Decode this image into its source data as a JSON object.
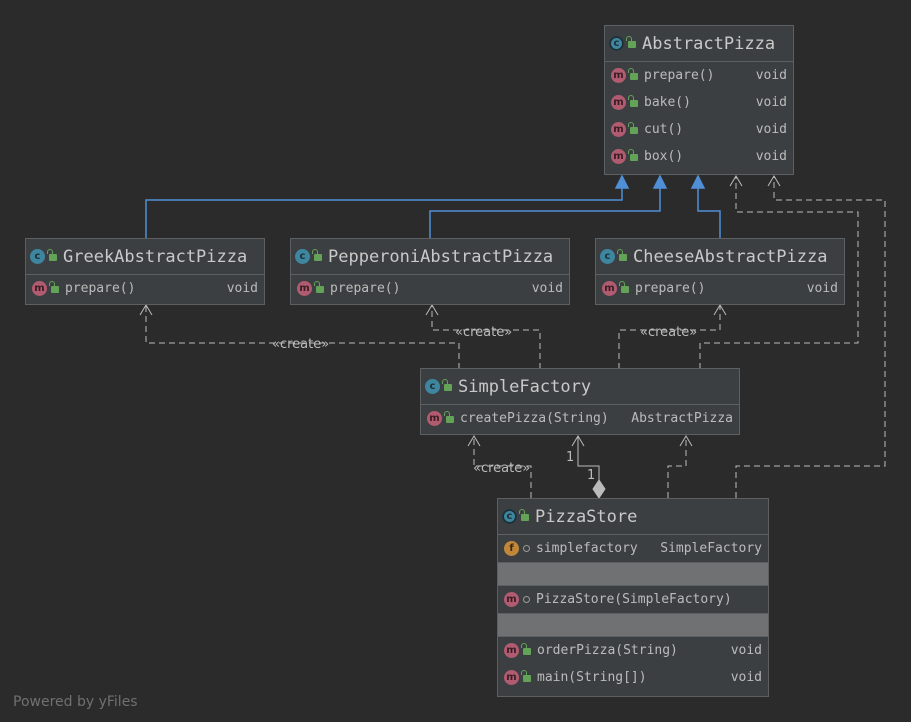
{
  "colors": {
    "background": "#2b2b2b",
    "node_fill": "#3c3f41",
    "node_border": "#5d6062",
    "inheritance_edge": "#4f8fd6",
    "dependency_edge": "#bbbbbb",
    "class_badge": "#3e86a0",
    "method_badge": "#b05b70",
    "field_badge": "#c0873a",
    "public_lock": "#62a357"
  },
  "nodes": {
    "abstract_pizza": {
      "title": "AbstractPizza",
      "badge_icon": "abstract-class-icon",
      "badge_letter": "c",
      "methods": [
        {
          "name": "prepare()",
          "type": "void"
        },
        {
          "name": "bake()",
          "type": "void"
        },
        {
          "name": "cut()",
          "type": "void"
        },
        {
          "name": "box()",
          "type": "void"
        }
      ]
    },
    "greek": {
      "title": "GreekAbstractPizza",
      "badge_icon": "class-icon",
      "badge_letter": "c",
      "methods": [
        {
          "name": "prepare()",
          "type": "void"
        }
      ]
    },
    "pepperoni": {
      "title": "PepperoniAbstractPizza",
      "badge_icon": "class-icon",
      "badge_letter": "c",
      "methods": [
        {
          "name": "prepare()",
          "type": "void"
        }
      ]
    },
    "cheese": {
      "title": "CheeseAbstractPizza",
      "badge_icon": "class-icon",
      "badge_letter": "c",
      "methods": [
        {
          "name": "prepare()",
          "type": "void"
        }
      ]
    },
    "simple_factory": {
      "title": "SimpleFactory",
      "badge_icon": "class-icon",
      "badge_letter": "c",
      "methods": [
        {
          "name": "createPizza(String)",
          "type": "AbstractPizza"
        }
      ]
    },
    "pizza_store": {
      "title": "PizzaStore",
      "badge_icon": "class-icon",
      "badge_letter": "c",
      "fields": [
        {
          "name": "simplefactory",
          "type": "SimpleFactory",
          "badge_letter": "f"
        }
      ],
      "constructors": [
        {
          "name": "PizzaStore(SimpleFactory)",
          "type": ""
        }
      ],
      "methods": [
        {
          "name": "orderPizza(String)",
          "type": "void"
        },
        {
          "name": "main(String[])",
          "type": "void"
        }
      ]
    }
  },
  "method_badge_letter": "m",
  "edge_labels": {
    "create_greek": "«create»",
    "create_pepperoni": "«create»",
    "create_cheese": "«create»",
    "create_factory": "«create»",
    "multiplicity_a": "1",
    "multiplicity_b": "1"
  },
  "watermark": "Powered by yFiles"
}
